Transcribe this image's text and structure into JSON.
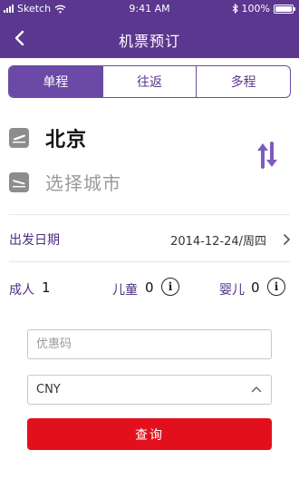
{
  "status_bar": {
    "carrier": "Sketch",
    "time": "9:41 AM",
    "battery": "100%",
    "battery_level": 1.0,
    "icons": [
      "signal-icon",
      "wifi-icon",
      "bluetooth-icon",
      "battery-icon"
    ]
  },
  "nav": {
    "title": "机票预订",
    "back_icon": "chevron-left-icon"
  },
  "trip_tabs": {
    "items": [
      {
        "label": "单程",
        "active": true
      },
      {
        "label": "往返",
        "active": false
      },
      {
        "label": "多程",
        "active": false
      }
    ]
  },
  "route": {
    "from_city": "北京",
    "to_city_placeholder": "选择城市",
    "departure_icon": "plane-departure-icon",
    "arrival_icon": "plane-arrival-icon",
    "swap_icon": "swap-arrows-icon"
  },
  "date": {
    "label": "出发日期",
    "value": "2014-12-24/周四"
  },
  "passengers": {
    "adult_label": "成人",
    "adult_count": "1",
    "child_label": "儿童",
    "child_count": "0",
    "infant_label": "婴儿",
    "infant_count": "0",
    "info_glyph": "i"
  },
  "form": {
    "promo_placeholder": "优惠码",
    "currency": "CNY",
    "search_label": "查询"
  },
  "colors": {
    "primary": "#5b3790",
    "tab_active": "#6a4aa6",
    "search_button": "#e2101c",
    "swap_icon": "#7e5bc0"
  }
}
